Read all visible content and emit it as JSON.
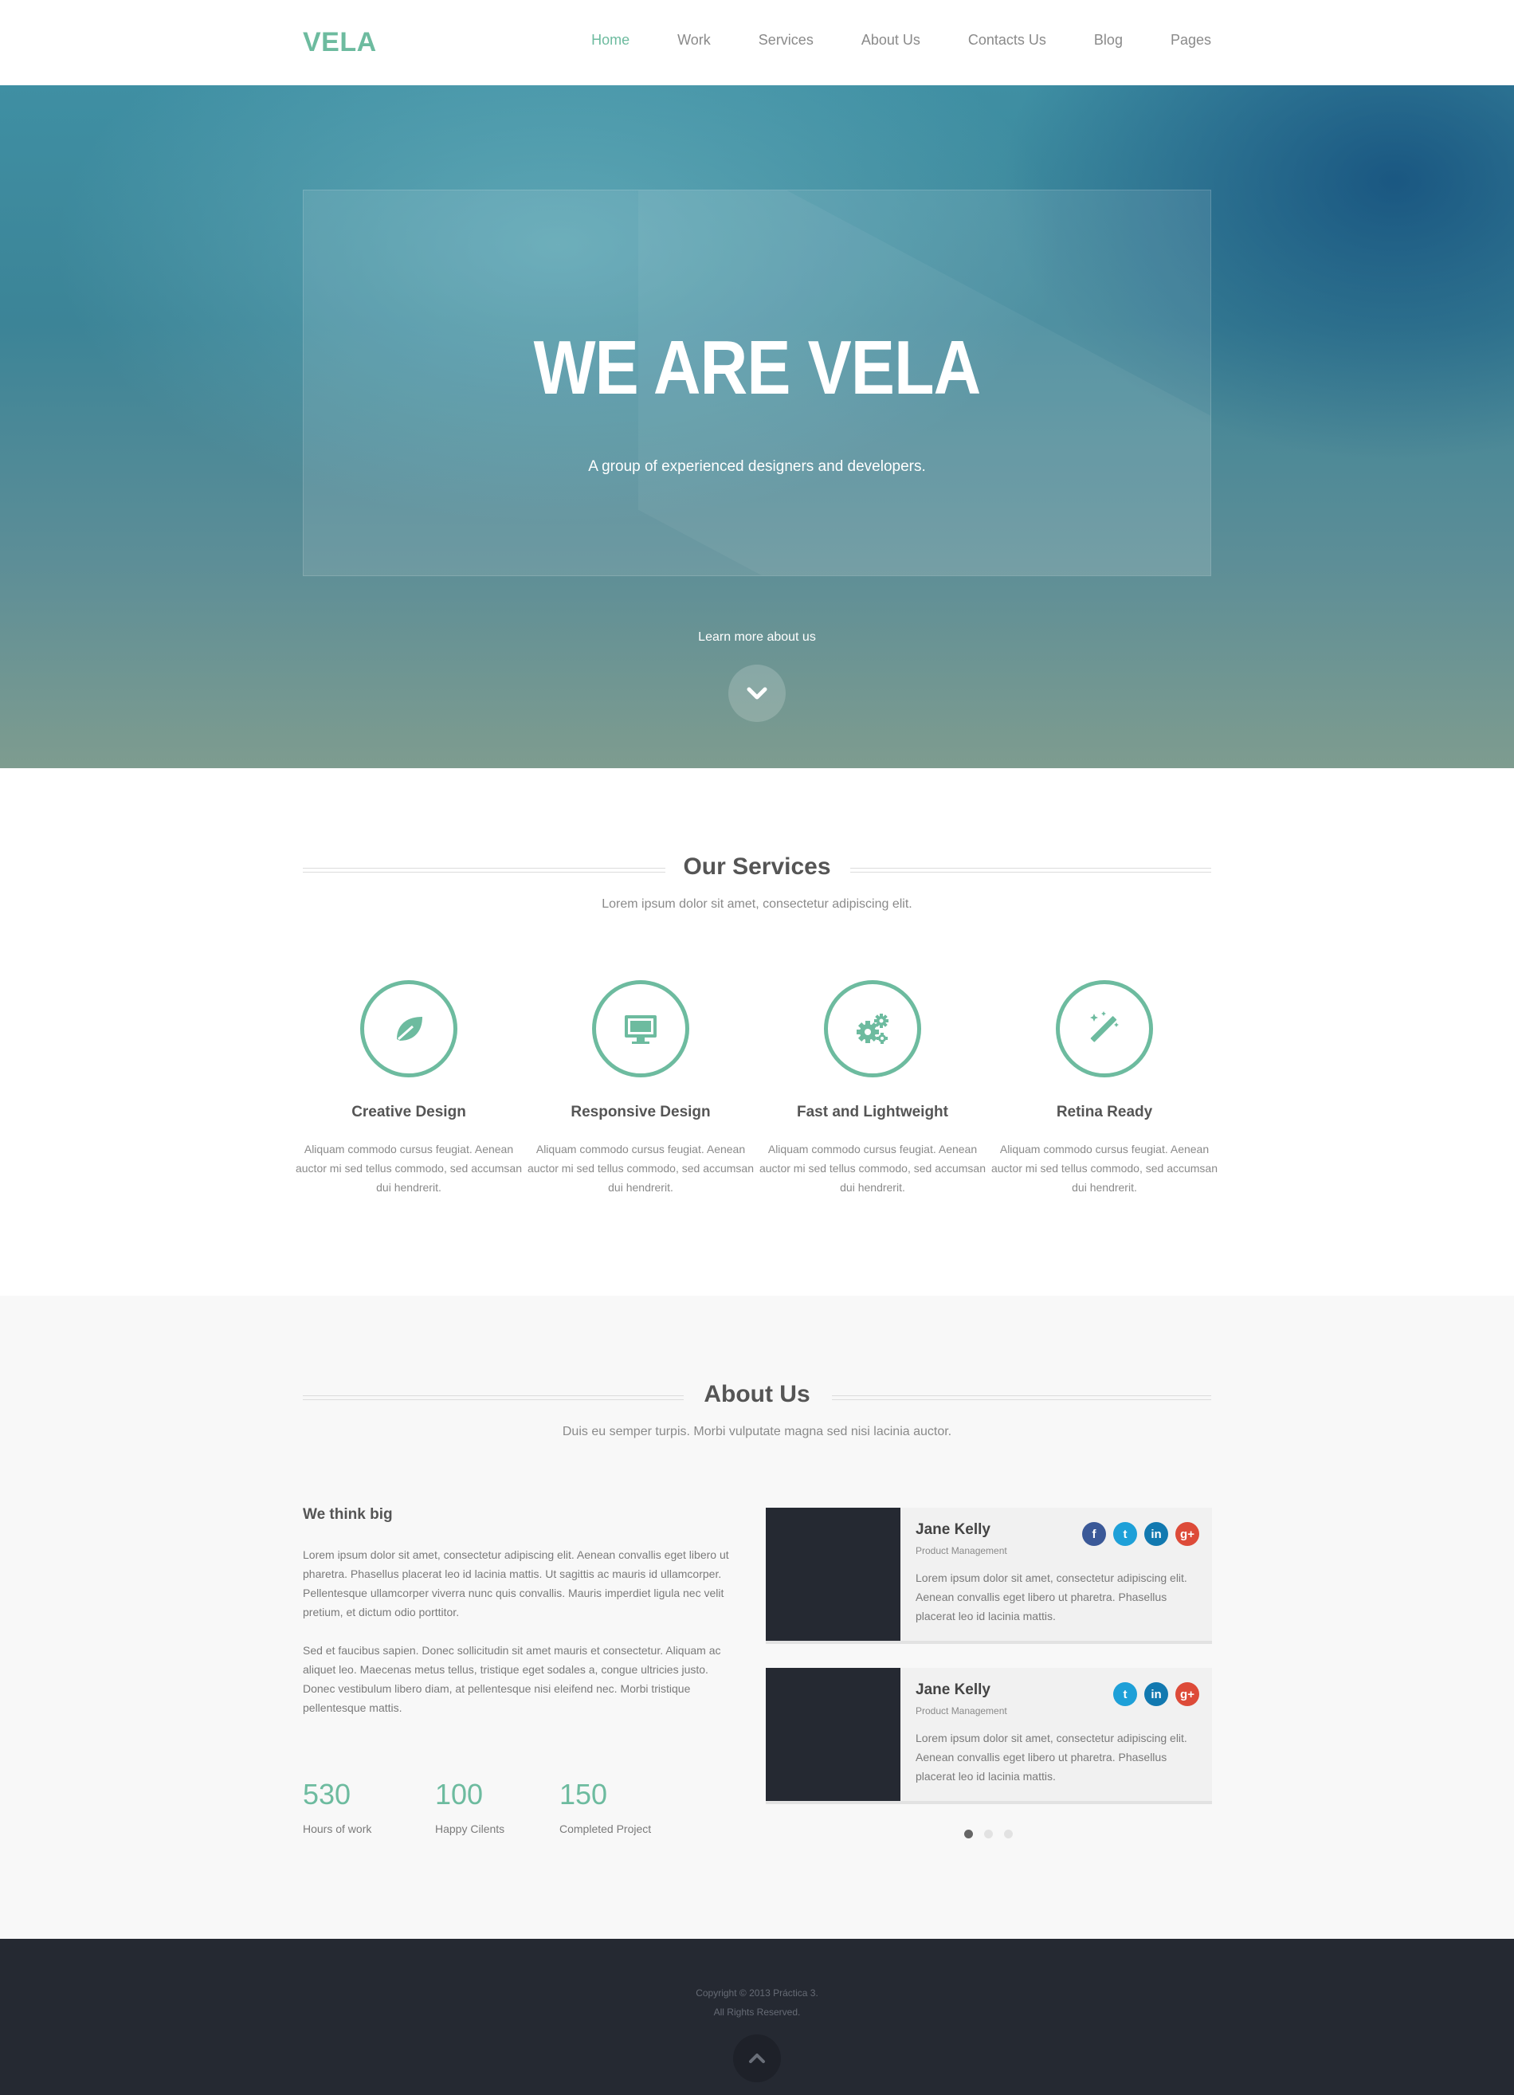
{
  "brand": {
    "logo": "VELA",
    "accent": "#6dbb9f",
    "dark": "#252932"
  },
  "nav": {
    "items": [
      {
        "label": "Home",
        "active": true
      },
      {
        "label": "Work"
      },
      {
        "label": "Services"
      },
      {
        "label": "About Us"
      },
      {
        "label": "Contacts Us"
      },
      {
        "label": "Blog"
      },
      {
        "label": "Pages"
      }
    ]
  },
  "hero": {
    "title": "WE ARE VELA",
    "subtitle": "A group of experienced designers and developers.",
    "learn_more": "Learn more about us",
    "down_icon": "chevron-down-icon"
  },
  "services": {
    "title": "Our Services",
    "subtitle": "Lorem ipsum dolor sit amet, consectetur adipiscing elit.",
    "items": [
      {
        "icon": "leaf-icon",
        "title": "Creative Design",
        "text": "Aliquam commodo cursus feugiat. Aenean auctor mi sed tellus commodo, sed accumsan dui hendrerit."
      },
      {
        "icon": "monitor-icon",
        "title": "Responsive Design",
        "text": "Aliquam commodo cursus feugiat. Aenean auctor mi sed tellus commodo, sed accumsan dui hendrerit."
      },
      {
        "icon": "gears-icon",
        "title": "Fast and Lightweight",
        "text": "Aliquam commodo cursus feugiat. Aenean auctor mi sed tellus commodo, sed accumsan dui hendrerit."
      },
      {
        "icon": "magic-wand-icon",
        "title": "Retina Ready",
        "text": "Aliquam commodo cursus feugiat. Aenean auctor mi sed tellus commodo, sed accumsan dui hendrerit."
      }
    ]
  },
  "about": {
    "title": "About Us",
    "subtitle": "Duis eu semper turpis. Morbi vulputate magna sed nisi lacinia auctor.",
    "heading": "We think big",
    "paragraphs": [
      "Lorem ipsum dolor sit amet, consectetur adipiscing elit. Aenean convallis eget libero ut pharetra. Phasellus placerat leo id lacinia mattis. Ut sagittis ac mauris id ullamcorper. Pellentesque ullamcorper viverra nunc quis convallis. Mauris imperdiet ligula nec velit pretium, et dictum odio porttitor.",
      "Sed et faucibus sapien. Donec sollicitudin sit amet mauris et consectetur. Aliquam ac aliquet leo. Maecenas metus tellus, tristique eget sodales a, congue ultricies justo. Donec vestibulum libero diam, at pellentesque nisi eleifend nec. Morbi tristique pellentesque mattis."
    ],
    "stats": [
      {
        "value": "530",
        "label": "Hours of work"
      },
      {
        "value": "100",
        "label": "Happy Cilents"
      },
      {
        "value": "150",
        "label": "Completed Project"
      }
    ],
    "team": [
      {
        "name": "Jane Kelly",
        "role": "Product Management",
        "bio": "Lorem ipsum dolor sit amet, consectetur adipiscing elit. Aenean convallis eget libero ut pharetra. Phasellus placerat leo id lacinia mattis.",
        "socials": [
          {
            "icon": "facebook-icon",
            "glyph": "f",
            "color": "#3b5998"
          },
          {
            "icon": "twitter-icon",
            "glyph": "t",
            "color": "#1ea0d8"
          },
          {
            "icon": "linkedin-icon",
            "glyph": "in",
            "color": "#1279b0"
          },
          {
            "icon": "google-plus-icon",
            "glyph": "g+",
            "color": "#dd4b39"
          }
        ]
      },
      {
        "name": "Jane Kelly",
        "role": "Product Management",
        "bio": "Lorem ipsum dolor sit amet, consectetur adipiscing elit. Aenean convallis eget libero ut pharetra. Phasellus placerat leo id lacinia mattis.",
        "socials": [
          {
            "icon": "twitter-icon",
            "glyph": "t",
            "color": "#1ea0d8"
          },
          {
            "icon": "linkedin-icon",
            "glyph": "in",
            "color": "#1279b0"
          },
          {
            "icon": "google-plus-icon",
            "glyph": "g+",
            "color": "#dd4b39"
          }
        ]
      }
    ],
    "slider": {
      "count": 3,
      "active": 1
    }
  },
  "footer": {
    "copyright": "Copyright © 2013 Práctica 3.",
    "rights": "All Rights Reserved.",
    "up_icon": "chevron-up-icon"
  }
}
